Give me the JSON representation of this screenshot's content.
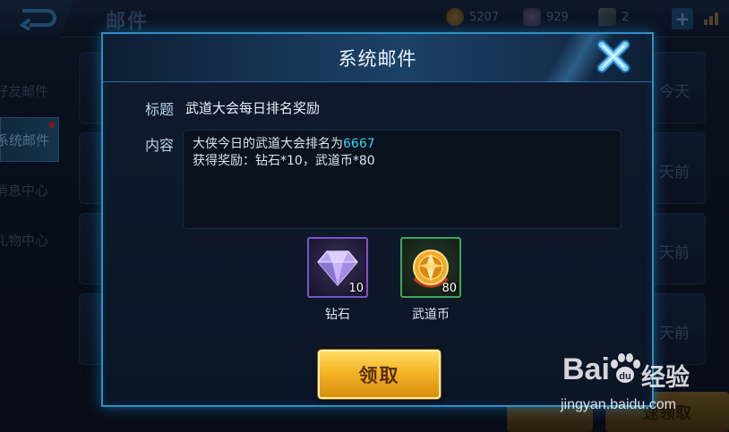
{
  "page": {
    "title": "邮件",
    "currencies": [
      {
        "icon": "gold-coin-icon",
        "value": "5207"
      },
      {
        "icon": "diamond-icon",
        "value": "929"
      },
      {
        "icon": "ticket-icon",
        "value": "2"
      }
    ],
    "sidebar": [
      {
        "label": "好友邮件",
        "active": false
      },
      {
        "label": "系统邮件",
        "active": true,
        "badge": true
      },
      {
        "label": "消息中心",
        "active": false
      },
      {
        "label": "礼物中心",
        "active": false
      }
    ],
    "list_times": [
      "今天",
      "天前",
      "天前",
      "天前"
    ],
    "bottom_right_button": "速领取"
  },
  "modal": {
    "title": "系统邮件",
    "subject_label": "标题",
    "subject_value": "武道大会每日排名奖励",
    "content_label": "内容",
    "content_line1_prefix": "大侠今日的武道大会排名为",
    "content_rank": "6667",
    "content_line2": "获得奖励：钻石*10，武道币*80",
    "rewards": [
      {
        "icon": "diamond-icon",
        "count": "10",
        "name": "钻石",
        "border_color": "#7a55c4"
      },
      {
        "icon": "wudao-coin-icon",
        "count": "80",
        "name": "武道币",
        "border_color": "#3da55a"
      }
    ],
    "claim_button": "领取",
    "accent_color": "#2f8fc7",
    "highlight_color": "#2fd6e6"
  },
  "watermark": {
    "brand": "Bai",
    "brand_cn": "经验",
    "url": "jingyan.baidu.com"
  }
}
